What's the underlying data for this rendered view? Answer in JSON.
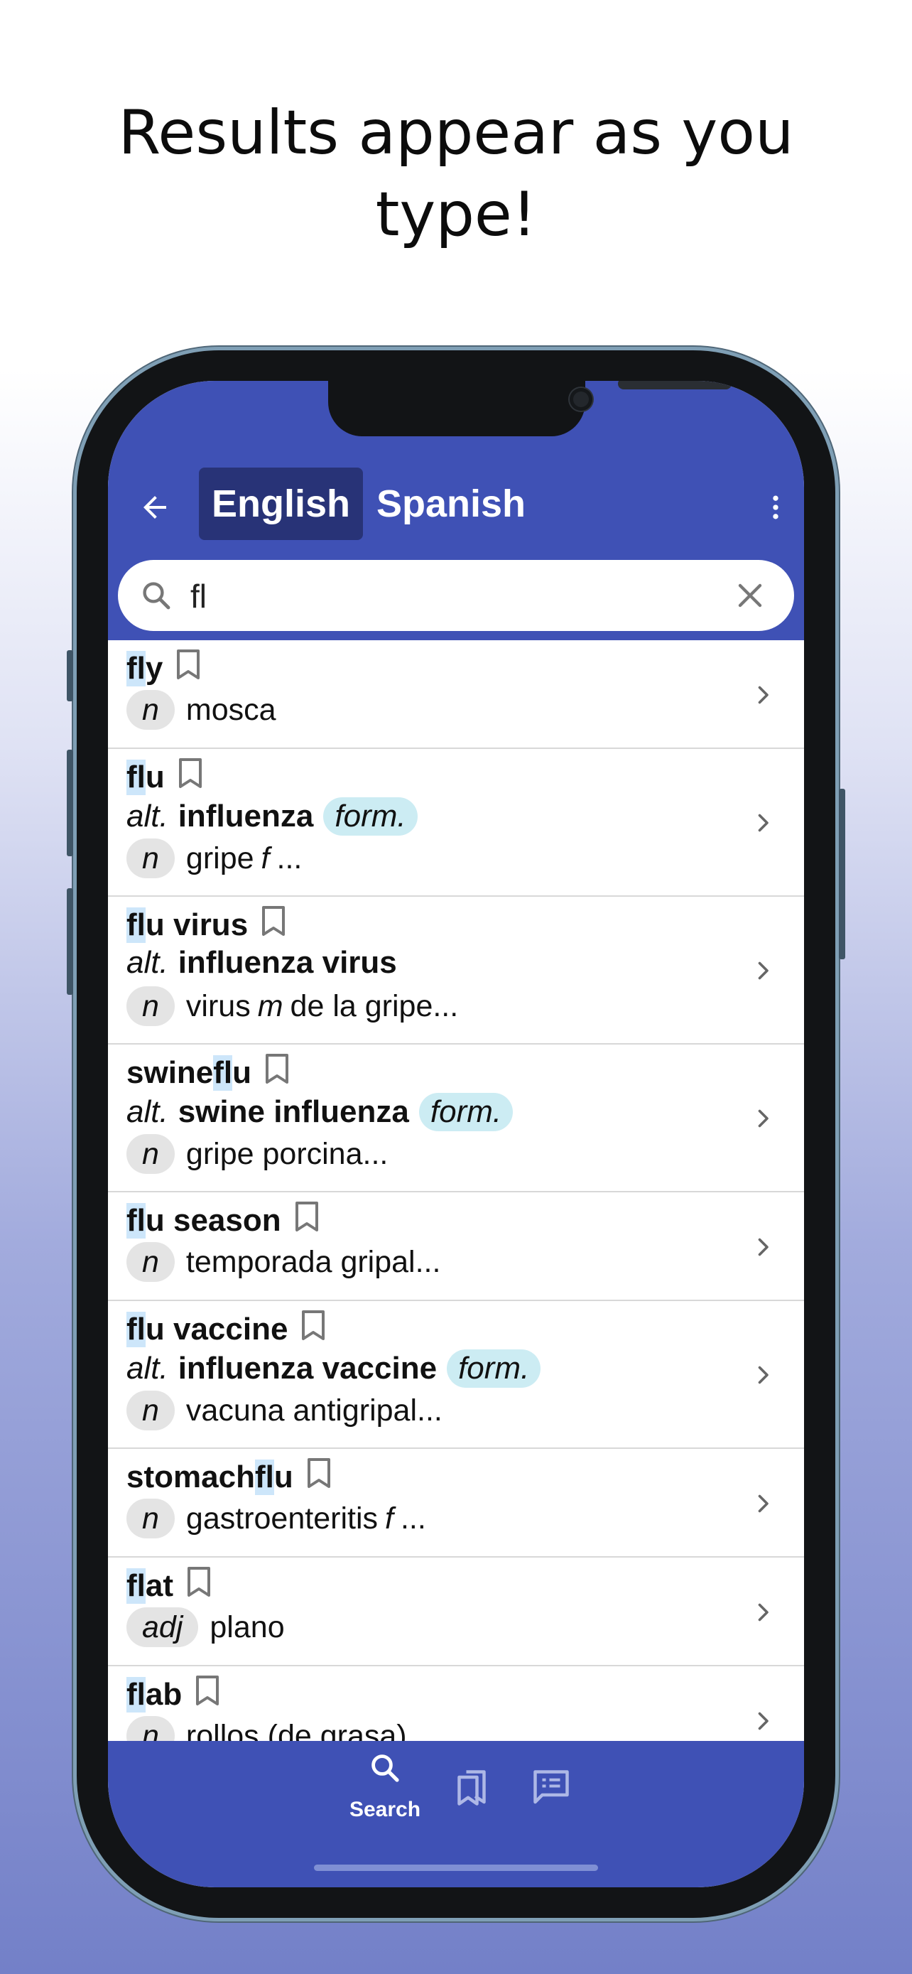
{
  "headline": {
    "line1": "Results appear as you",
    "line2": "type!"
  },
  "header": {
    "back_icon": "arrow-left-icon",
    "tabs": [
      {
        "label": "English",
        "selected": true
      },
      {
        "label": "Spanish",
        "selected": false
      }
    ],
    "more_icon": "more-vertical-icon"
  },
  "search": {
    "value": "fl",
    "placeholder": "",
    "search_icon": "search-icon",
    "clear_icon": "close-icon"
  },
  "colors": {
    "primary": "#3f51b5",
    "selected_tab": "#283377",
    "highlight": "#cde6fa",
    "formal_tag": "#ccecf3",
    "pos_badge": "#e4e4e4"
  },
  "results": [
    {
      "pre": "",
      "match": "fl",
      "post": "y",
      "defs": [
        {
          "pos": "n",
          "text": "mosca"
        }
      ]
    },
    {
      "pre": "",
      "match": "fl",
      "post": "u",
      "alt_prefix": "alt.",
      "alt": "influenza",
      "tag": "form.",
      "defs": [
        {
          "pos": "n",
          "text": "gripe",
          "gender": "f",
          "suffix": "..."
        }
      ]
    },
    {
      "pre": "",
      "match": "fl",
      "post": "u virus",
      "alt_prefix": "alt.",
      "alt": "influenza virus",
      "defs": [
        {
          "pos": "n",
          "text": "virus",
          "gender": "m",
          "suffix": "de la gripe..."
        }
      ]
    },
    {
      "pre": "swine ",
      "match": "fl",
      "post": "u",
      "alt_prefix": "alt.",
      "alt": "swine influenza",
      "tag": "form.",
      "defs": [
        {
          "pos": "n",
          "text": "gripe porcina..."
        }
      ]
    },
    {
      "pre": "",
      "match": "fl",
      "post": "u season",
      "defs": [
        {
          "pos": "n",
          "text": "temporada gripal..."
        }
      ]
    },
    {
      "pre": "",
      "match": "fl",
      "post": "u vaccine",
      "alt_prefix": "alt.",
      "alt": "influenza vaccine",
      "tag": "form.",
      "defs": [
        {
          "pos": "n",
          "text": "vacuna antigripal..."
        }
      ]
    },
    {
      "pre": "stomach ",
      "match": "fl",
      "post": "u",
      "defs": [
        {
          "pos": "n",
          "text": "gastroenteritis",
          "gender": "f",
          "suffix": "..."
        }
      ]
    },
    {
      "pre": "",
      "match": "fl",
      "post": "at",
      "defs": [
        {
          "pos": "adj",
          "text": "plano"
        }
      ]
    },
    {
      "pre": "",
      "match": "fl",
      "post": "ab",
      "defs": [
        {
          "pos": "n",
          "text": "rollos (de grasa)"
        }
      ]
    }
  ],
  "bottom_nav": [
    {
      "label": "Search",
      "icon": "search-icon",
      "active": true
    },
    {
      "label": "",
      "icon": "bookmarks-icon",
      "active": false
    },
    {
      "label": "",
      "icon": "list-icon",
      "active": false
    }
  ]
}
